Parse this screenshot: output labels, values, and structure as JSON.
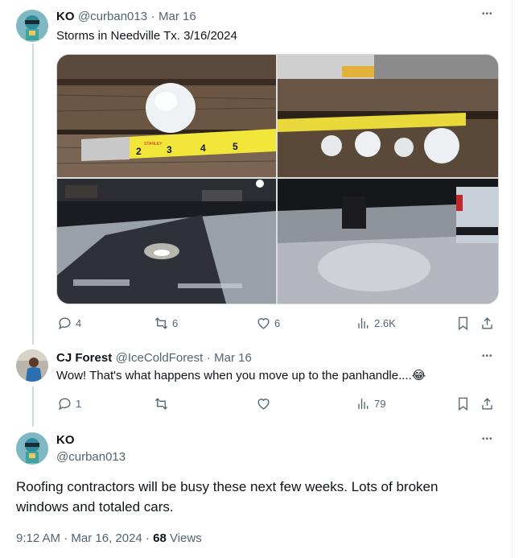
{
  "tweet1": {
    "name": "KO",
    "handle": "@curban013",
    "date": "Mar 16",
    "text": "Storms in Needville Tx.  3/16/2024",
    "replies": "4",
    "retweets": "6",
    "likes": "6",
    "views": "2.6K"
  },
  "tweet2": {
    "name": "CJ Forest",
    "handle": "@IceColdForest",
    "date": "Mar 16",
    "text": "Wow! That's what happens when you move up to the panhandle....",
    "emoji": "😂",
    "replies": "1",
    "views": "79"
  },
  "tweet3": {
    "name": "KO",
    "handle": "@curban013",
    "text_line1": "Roofing contractors will be busy these next few weeks.  Lots of broken",
    "text_line2": "windows and totaled cars.",
    "time": "9:12 AM",
    "full_date": "Mar 16, 2024",
    "views_count": "68",
    "views_label": "Views"
  },
  "separator": "·",
  "more_glyph": "•••",
  "ruler": {
    "numbers_a": [
      "2",
      "3",
      "4",
      "5"
    ],
    "brand": "STANLEY"
  },
  "colors": {
    "accent": "#1d9bf0",
    "muted": "#536471",
    "line": "#cfd9de"
  },
  "icons": [
    "reply-icon",
    "retweet-icon",
    "like-icon",
    "views-icon",
    "bookmark-icon",
    "share-icon",
    "more-icon"
  ]
}
